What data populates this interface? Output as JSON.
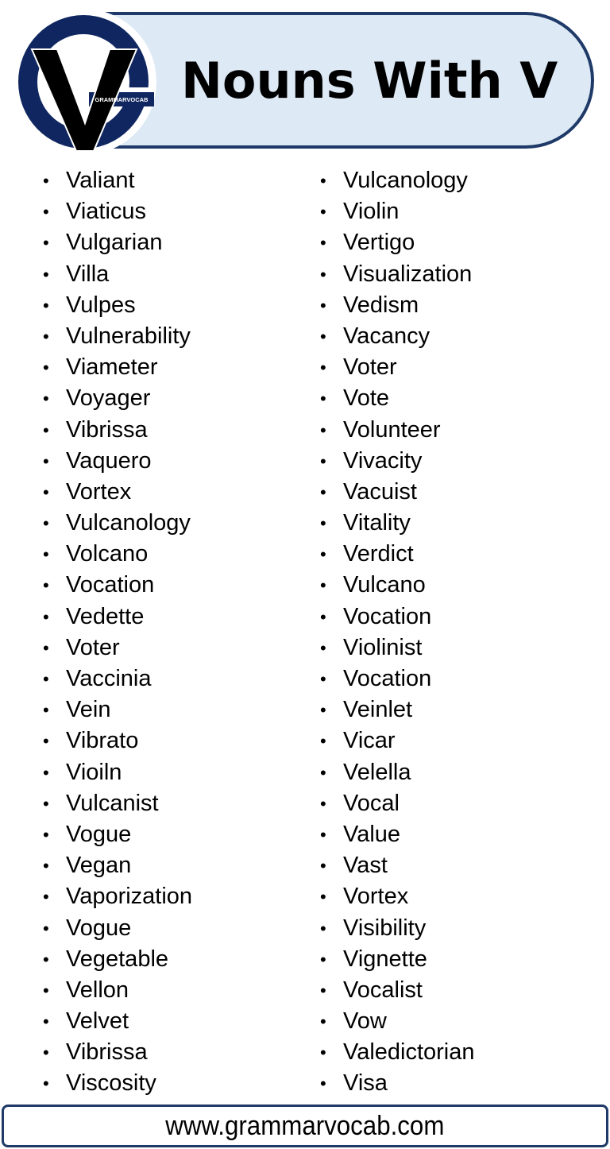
{
  "header": {
    "title": "Nouns With V",
    "logo_text": "GRAMMARVOCAB",
    "colors": {
      "pill_fill": "#dde9f5",
      "pill_border": "#1f3a68",
      "logo_ring": "#0f2660",
      "logo_v": "#000000"
    }
  },
  "lists": {
    "left": [
      "Valiant",
      "Viaticus",
      "Vulgarian",
      "Villa",
      "Vulpes",
      "Vulnerability",
      "Viameter",
      "Voyager",
      "Vibrissa",
      "Vaquero",
      "Vortex",
      "Vulcanology",
      "Volcano",
      "Vocation",
      "Vedette",
      "Voter",
      "Vaccinia",
      "Vein",
      "Vibrato",
      "Vioiln",
      "Vulcanist",
      "Vogue",
      "Vegan",
      "Vaporization",
      "Vogue",
      "Vegetable",
      "Vellon",
      "Velvet",
      "Vibrissa",
      "Viscosity"
    ],
    "right": [
      "Vulcanology",
      "Violin",
      "Vertigo",
      "Visualization",
      "Vedism",
      "Vacancy",
      "Voter",
      "Vote",
      "Volunteer",
      "Vivacity",
      "Vacuist",
      "Vitality",
      "Verdict",
      "Vulcano",
      "Vocation",
      "Violinist",
      "Vocation",
      "Veinlet",
      "Vicar",
      "Velella",
      "Vocal",
      "Value",
      "Vast",
      "Vortex",
      "Visibility",
      "Vignette",
      "Vocalist",
      "Vow",
      "Valedictorian",
      "Visa"
    ],
    "bullet_char": "•"
  },
  "footer": {
    "url": "www.grammarvocab.com"
  }
}
